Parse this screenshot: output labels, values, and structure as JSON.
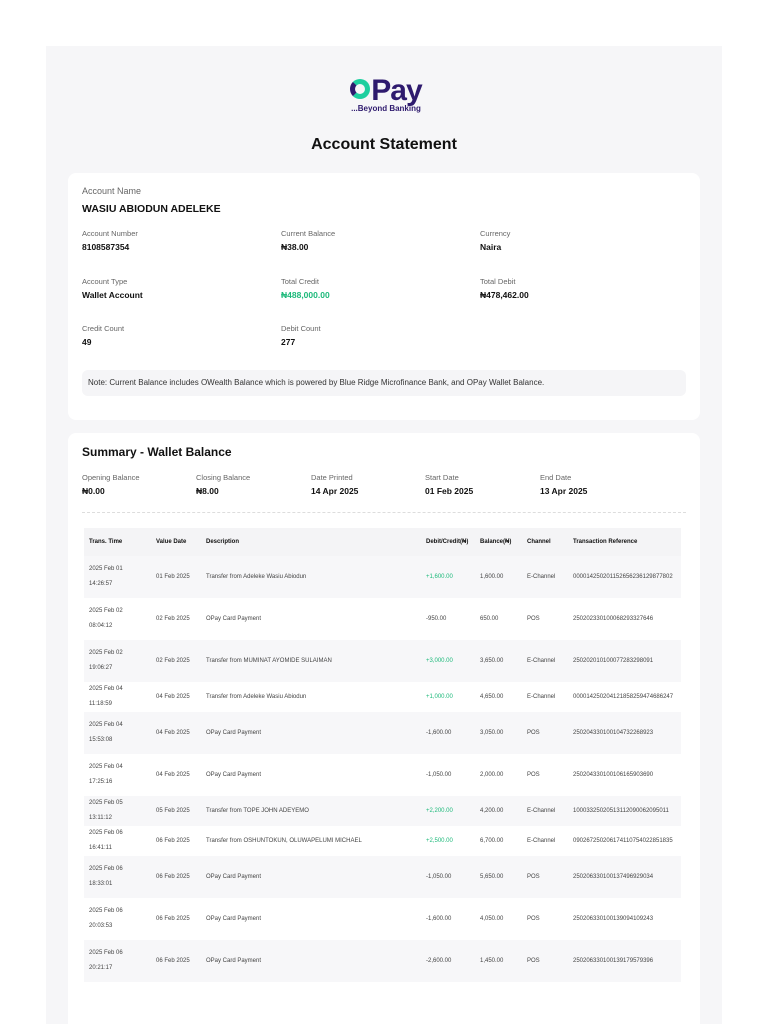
{
  "logo": {
    "word": "Pay",
    "tagline": "...Beyond Banking"
  },
  "title": "Account Statement",
  "account": {
    "name_label": "Account Name",
    "name": "WASIU ABIODUN ADELEKE",
    "number_label": "Account Number",
    "number": "8108587354",
    "current_balance_label": "Current Balance",
    "current_balance": "₦38.00",
    "currency_label": "Currency",
    "currency": "Naira",
    "type_label": "Account Type",
    "type": "Wallet Account",
    "total_credit_label": "Total Credit",
    "total_credit": "₦488,000.00",
    "total_debit_label": "Total Debit",
    "total_debit": "₦478,462.00",
    "credit_count_label": "Credit Count",
    "credit_count": "49",
    "debit_count_label": "Debit Count",
    "debit_count": "277",
    "note": "Note: Current Balance includes OWealth Balance which is powered by Blue Ridge Microfinance Bank, and OPay Wallet Balance."
  },
  "summary": {
    "title": "Summary - Wallet Balance",
    "opening_label": "Opening Balance",
    "opening": "₦0.00",
    "closing_label": "Closing Balance",
    "closing": "₦8.00",
    "printed_label": "Date Printed",
    "printed": "14 Apr 2025",
    "start_label": "Start Date",
    "start": "01 Feb 2025",
    "end_label": "End Date",
    "end": "13 Apr 2025"
  },
  "table": {
    "headers": [
      "Trans. Time",
      "Value Date",
      "Description",
      "Debit/Credit(₦)",
      "Balance(₦)",
      "Channel",
      "Transaction Reference"
    ],
    "rows": [
      [
        "2025 Feb 01 14:26:57",
        "01 Feb 2025",
        "Transfer from Adeleke Wasiu Abiodun",
        "+1,600.00",
        "1,600.00",
        "E-Channel",
        "000014250201152656236129877802"
      ],
      [
        "2025 Feb 02 08:04:12",
        "02 Feb 2025",
        "OPay Card Payment",
        "-950.00",
        "650.00",
        "POS",
        "250202330100068293327646"
      ],
      [
        "2025 Feb 02 19:06:27",
        "02 Feb 2025",
        "Transfer from MUMINAT AYOMIDE SULAIMAN",
        "+3,000.00",
        "3,650.00",
        "E-Channel",
        "250202010100077283298091"
      ],
      [
        "2025 Feb 04 11:18:59",
        "04 Feb 2025",
        "Transfer from Adeleke Wasiu Abiodun",
        "+1,000.00",
        "4,650.00",
        "E-Channel",
        "000014250204121858259474686247"
      ],
      [
        "2025 Feb 04 15:53:08",
        "04 Feb 2025",
        "OPay Card Payment",
        "-1,600.00",
        "3,050.00",
        "POS",
        "250204330100104732268923"
      ],
      [
        "2025 Feb 04 17:25:16",
        "04 Feb 2025",
        "OPay Card Payment",
        "-1,050.00",
        "2,000.00",
        "POS",
        "250204330100106165903690"
      ],
      [
        "2025 Feb 05 13:11:12",
        "05 Feb 2025",
        "Transfer from TOPE JOHN ADEYEMO",
        "+2,200.00",
        "4,200.00",
        "E-Channel",
        "100033250205131120900620950​11"
      ],
      [
        "2025 Feb 06 16:41:11",
        "06 Feb 2025",
        "Transfer from OSHUNTOKUN, OLUWAPELUMI MICHAEL",
        "+2,500.00",
        "6,700.00",
        "E-Channel",
        "090267250206174110754022851835"
      ],
      [
        "2025 Feb 06 18:33:01",
        "06 Feb 2025",
        "OPay Card Payment",
        "-1,050.00",
        "5,650.00",
        "POS",
        "250206330100137496929034"
      ],
      [
        "2025 Feb 06 20:03:53",
        "06 Feb 2025",
        "OPay Card Payment",
        "-1,600.00",
        "4,050.00",
        "POS",
        "250206330100139094109243"
      ],
      [
        "2025 Feb 06 20:21:17",
        "06 Feb 2025",
        "OPay Card Payment",
        "-2,600.00",
        "1,450.00",
        "POS",
        "250206330100139179579396"
      ]
    ],
    "wrap": [
      true,
      true,
      true,
      false,
      true,
      true,
      false,
      false,
      true,
      true,
      true
    ]
  },
  "colors": {
    "credit": "#1cb97a",
    "brand": "#2e1a6e",
    "accent": "#1dcf9f"
  }
}
